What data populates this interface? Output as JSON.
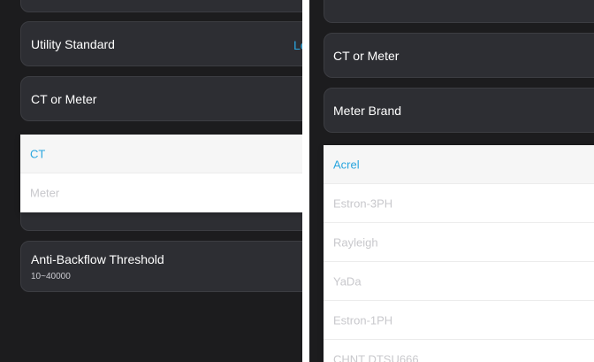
{
  "left": {
    "utility_standard": {
      "label": "Utility Standard",
      "value": "Le"
    },
    "ct_or_meter": {
      "label": "CT or Meter"
    },
    "options": [
      "CT",
      "Meter"
    ],
    "anti_backflow": {
      "label": "Anti-Backflow Threshold",
      "range": "10~40000"
    }
  },
  "right": {
    "ct_or_meter": {
      "label": "CT or Meter"
    },
    "meter_brand": {
      "label": "Meter Brand"
    },
    "options": [
      "Acrel",
      "Estron-3PH",
      "Rayleigh",
      "YaDa",
      "Estron-1PH",
      "CHNT DTSU666"
    ]
  },
  "colors": {
    "accent": "#2aa6df",
    "card_bg": "#2d2e33",
    "page_bg": "#1c1c1e"
  }
}
